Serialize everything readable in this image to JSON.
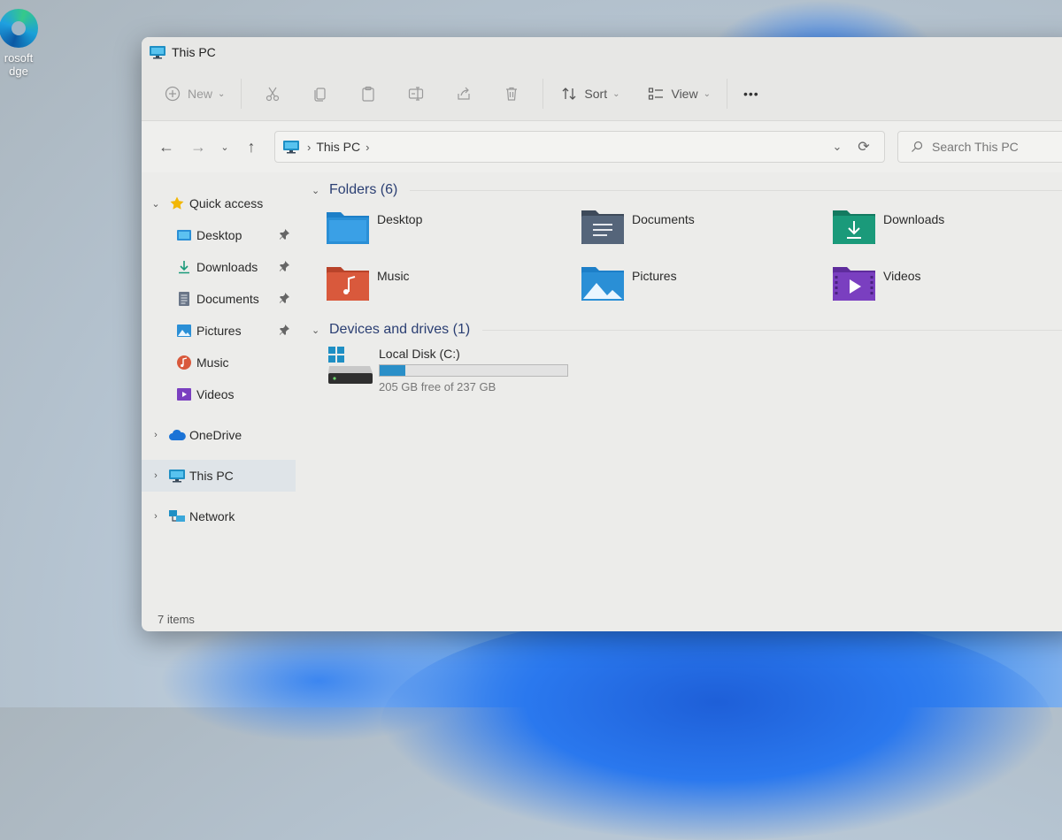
{
  "desktop": {
    "edge_label_line1": "rosoft",
    "edge_label_line2": "dge"
  },
  "window": {
    "title": "This PC"
  },
  "commandbar": {
    "new_label": "New",
    "sort_label": "Sort",
    "view_label": "View",
    "more_label": "•••"
  },
  "addressbar": {
    "crumb": "This PC",
    "search_placeholder": "Search This PC"
  },
  "sidebar": {
    "quick_access": "Quick access",
    "items": [
      {
        "label": "Desktop",
        "icon": "desktop-folder-icon"
      },
      {
        "label": "Downloads",
        "icon": "downloads-icon"
      },
      {
        "label": "Documents",
        "icon": "documents-icon"
      },
      {
        "label": "Pictures",
        "icon": "pictures-icon"
      },
      {
        "label": "Music",
        "icon": "music-icon"
      },
      {
        "label": "Videos",
        "icon": "videos-icon"
      }
    ],
    "onedrive": "OneDrive",
    "this_pc": "This PC",
    "network": "Network"
  },
  "main": {
    "folders_header": "Folders (6)",
    "folders": [
      {
        "name": "Desktop",
        "color": "#2a8fd6"
      },
      {
        "name": "Documents",
        "color": "#55657a"
      },
      {
        "name": "Downloads",
        "color": "#1a9a7a"
      },
      {
        "name": "Music",
        "color": "#d9593c"
      },
      {
        "name": "Pictures",
        "color": "#2a8fd6"
      },
      {
        "name": "Videos",
        "color": "#7a3fc0"
      }
    ],
    "drives_header": "Devices and drives (1)",
    "drive": {
      "name": "Local Disk (C:)",
      "free_text": "205 GB free of 237 GB",
      "used_fraction": 0.135
    }
  },
  "status": {
    "items": "7 items"
  },
  "colors": {
    "accent": "#2a8fc8",
    "header_text": "#2b3f73"
  }
}
